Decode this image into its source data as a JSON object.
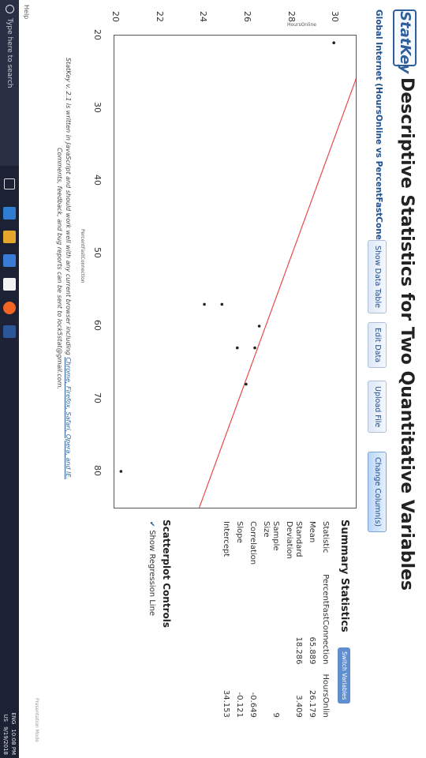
{
  "app": {
    "logo": "StatKey",
    "title": "Descriptive Statistics for Two Quantitative Variables"
  },
  "toolbar": {
    "dataset": "Global Internet (HoursOnline vs PercentFastConection)",
    "dataset_arrow": "▼",
    "show_data_table": "Show Data Table",
    "edit_data": "Edit Data",
    "upload_file": "Upload File",
    "change_columns": "Change Column(s)"
  },
  "chart_data": {
    "type": "scatter",
    "xlabel": "PercentFastConnection",
    "ylabel": "HoursOnline",
    "xlim": [
      20,
      85
    ],
    "ylim": [
      20,
      31
    ],
    "xticks": [
      "20",
      "30",
      "40",
      "50",
      "60",
      "70",
      "80"
    ],
    "yticks": [
      "20",
      "22",
      "24",
      "26",
      "28",
      "30"
    ],
    "points": [
      {
        "x": 80,
        "y": 20.3
      },
      {
        "x": 57,
        "y": 24.1
      },
      {
        "x": 57,
        "y": 24.9
      },
      {
        "x": 63,
        "y": 25.6
      },
      {
        "x": 68,
        "y": 26.0
      },
      {
        "x": 63,
        "y": 26.4
      },
      {
        "x": 60,
        "y": 26.6
      },
      {
        "x": 21,
        "y": 30.0
      }
    ],
    "regression": {
      "slope": -0.121,
      "intercept": 34.153
    },
    "grid": false,
    "line_color": "#e84a4a",
    "point_color": "#222222"
  },
  "summary": {
    "title": "Summary Statistics",
    "switch_label": "Switch Variables",
    "columns": [
      "Statistic",
      "PercentFastConnection",
      "HoursOnlin"
    ],
    "rows": [
      {
        "label": "Mean",
        "a": "65.889",
        "b": "26.179"
      },
      {
        "label": "Standard Deviation",
        "a": "18.286",
        "b": "3.409"
      },
      {
        "label": "Sample Size",
        "a": "",
        "b": "9"
      },
      {
        "label": "Correlation",
        "a": "",
        "b": "-0.649"
      },
      {
        "label": "Slope",
        "a": "",
        "b": "-0.121"
      },
      {
        "label": "Intercept",
        "a": "",
        "b": "34.153"
      }
    ]
  },
  "scatterplot_controls": {
    "title": "Scatterplot Controls",
    "show_regression": "Show Regression Line"
  },
  "footer": {
    "line1": "StatKey v. 2.1 is written in JavaScript and should work well with any current browser including",
    "browsers": "Chrome, Firefox, Safari, Opera, and IE.",
    "line2": "Comments, feedback, and bug reports can be sent to lock5stat@gmail.com."
  },
  "help": "Help",
  "presentation_mode": "Presentation Mode",
  "taskbar": {
    "search_placeholder": "Type here to search",
    "lang": "ENG",
    "region": "US",
    "time": "10:08 PM",
    "date": "9/19/2018"
  },
  "colors": {
    "brand": "#2f5f9a",
    "taskbar": "#1c2233",
    "regression": "#e84a4a"
  }
}
